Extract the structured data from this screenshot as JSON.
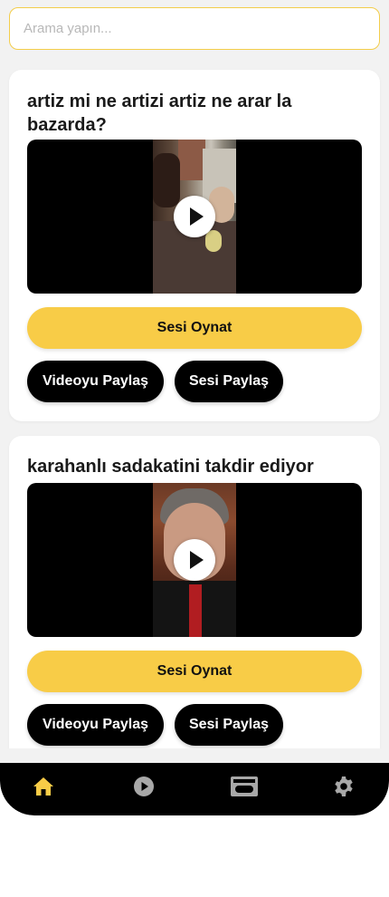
{
  "search": {
    "placeholder": "Arama yapın..."
  },
  "cards": [
    {
      "title": "artiz mi ne artizi artiz ne arar la bazarda?",
      "play_sound_label": "Sesi Oynat",
      "share_video_label": "Videoyu Paylaş",
      "share_sound_label": "Sesi Paylaş"
    },
    {
      "title": "karahanlı sadakatini takdir ediyor",
      "play_sound_label": "Sesi Oynat",
      "share_video_label": "Videoyu Paylaş",
      "share_sound_label": "Sesi Paylaş"
    }
  ],
  "tabbar": {
    "items": [
      {
        "icon": "home-icon",
        "active": true
      },
      {
        "icon": "play-circle-icon",
        "active": false
      },
      {
        "icon": "video-tape-icon",
        "active": false
      },
      {
        "icon": "gear-icon",
        "active": false
      }
    ]
  },
  "colors": {
    "accent": "#f8cc47",
    "background": "#f2f2f2",
    "card": "#ffffff",
    "tabbar": "#000000",
    "active_icon": "#f8cc47",
    "inactive_icon": "#a8a8a8"
  }
}
